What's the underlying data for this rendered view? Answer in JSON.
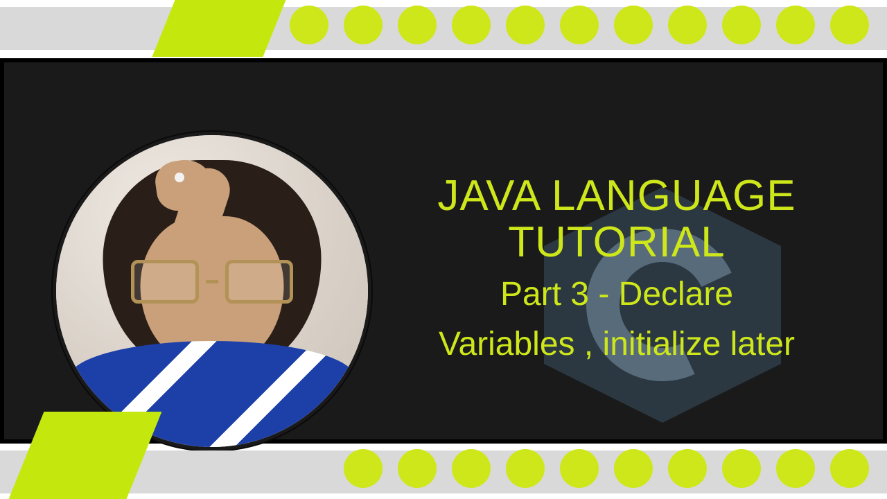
{
  "thumbnail": {
    "title_line1": "JAVA LANGUAGE",
    "title_line2": "TUTORIAL",
    "subtitle_line1": "Part 3 - Declare",
    "subtitle_line2": "Variables , initialize later"
  },
  "decor": {
    "top_dot_count": 11,
    "bottom_dot_count": 10,
    "accent_color": "#cee71a",
    "band_color": "#1a1a1a",
    "grey_bar_color": "#d9d9d9"
  },
  "logo": {
    "shape": "hexagon",
    "letter": "C"
  },
  "presenter": {
    "description": "person with long dark hair, glasses, hand on forehead, blue and white striped polo shirt",
    "frame": "circle"
  }
}
